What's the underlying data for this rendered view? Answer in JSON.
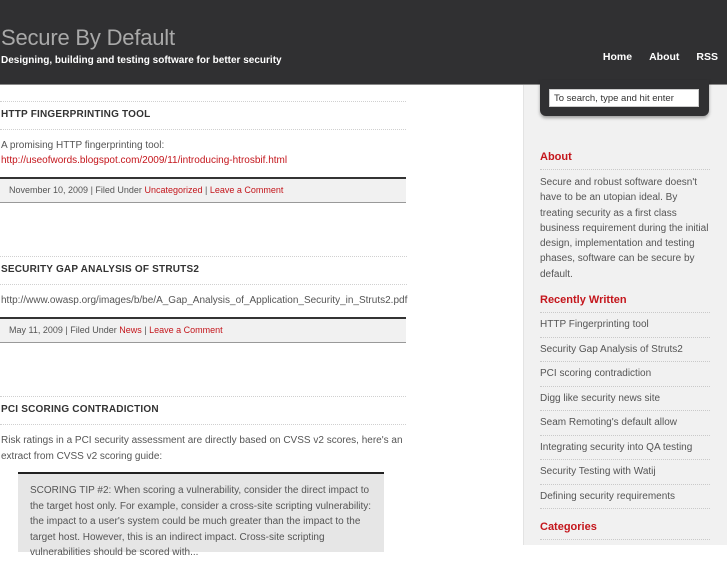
{
  "header": {
    "site_title": "Secure By Default",
    "tagline": "Designing, building and testing software for better security",
    "nav": [
      "Home",
      "About",
      "RSS"
    ]
  },
  "search": {
    "placeholder": "To search, type and hit enter"
  },
  "posts": [
    {
      "title": "HTTP FINGERPRINTING TOOL",
      "body_text": "A promising HTTP fingerprinting tool:",
      "body_link": "http://useofwords.blogspot.com/2009/11/introducing-htrosbif.html",
      "date": "November 10, 2009",
      "filed_under_label": "Filed Under",
      "category": "Uncategorized",
      "comment_link": "Leave a Comment"
    },
    {
      "title": "SECURITY GAP ANALYSIS OF STRUTS2",
      "body_text": "http://www.owasp.org/images/b/be/A_Gap_Analysis_of_Application_Security_in_Struts2.pdf",
      "date": "May 11, 2009",
      "filed_under_label": "Filed Under",
      "category": "News",
      "comment_link": "Leave a Comment"
    },
    {
      "title": "PCI SCORING CONTRADICTION",
      "body_text": "Risk ratings in a PCI security assessment are directly based on CVSS v2 scores, here's an extract from CVSS v2 scoring guide:",
      "quote": "SCORING TIP #2: When scoring a vulnerability, consider the direct impact to the target host only. For example, consider a cross-site scripting vulnerability: the impact to a user's system could be much greater than the impact to the target host. However, this is an indirect impact. Cross-site scripting vulnerabilities should be scored with..."
    }
  ],
  "sidebar": {
    "about": {
      "heading": "About",
      "text": "Secure and robust software doesn't have to be an utopian ideal. By treating security as a first class business requirement during the initial design, implementation and testing phases, software can be secure by default."
    },
    "recent": {
      "heading": "Recently Written",
      "items": [
        "HTTP Fingerprinting tool",
        "Security Gap Analysis of Struts2",
        "PCI scoring contradiction",
        "Digg like security news site",
        "Seam Remoting's default allow",
        "Integrating security into QA testing",
        "Security Testing with Watij",
        "Defining security requirements"
      ]
    },
    "categories": {
      "heading": "Categories"
    }
  },
  "colors": {
    "accent": "#c4161c",
    "header_bg": "#303032",
    "sidebar_bg": "#f1f1f1"
  }
}
